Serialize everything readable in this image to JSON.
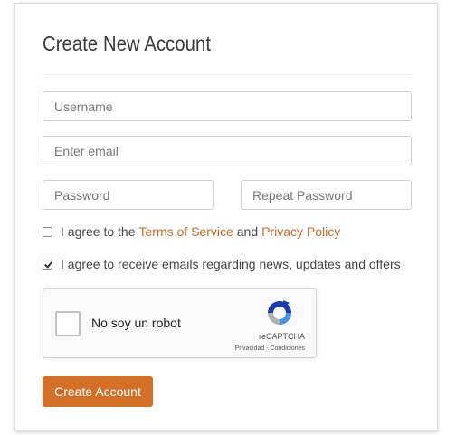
{
  "form": {
    "title": "Create New Account",
    "username_placeholder": "Username",
    "email_placeholder": "Enter email",
    "password_placeholder": "Password",
    "repeat_password_placeholder": "Repeat Password",
    "terms": {
      "prefix": "I agree to the",
      "terms_link": "Terms of Service",
      "and": "and",
      "privacy_link": "Privacy Policy",
      "checked": false
    },
    "emails": {
      "label": "I agree to receive emails regarding news, updates and offers",
      "checked": true
    },
    "recaptcha": {
      "label": "No soy un robot",
      "brand": "reCAPTCHA",
      "links": "Privacidad - Condiciones",
      "logo_icon": "recaptcha-logo-icon"
    },
    "submit_label": "Create Account"
  },
  "colors": {
    "accent": "#d46f28",
    "link": "#c56a2a"
  }
}
